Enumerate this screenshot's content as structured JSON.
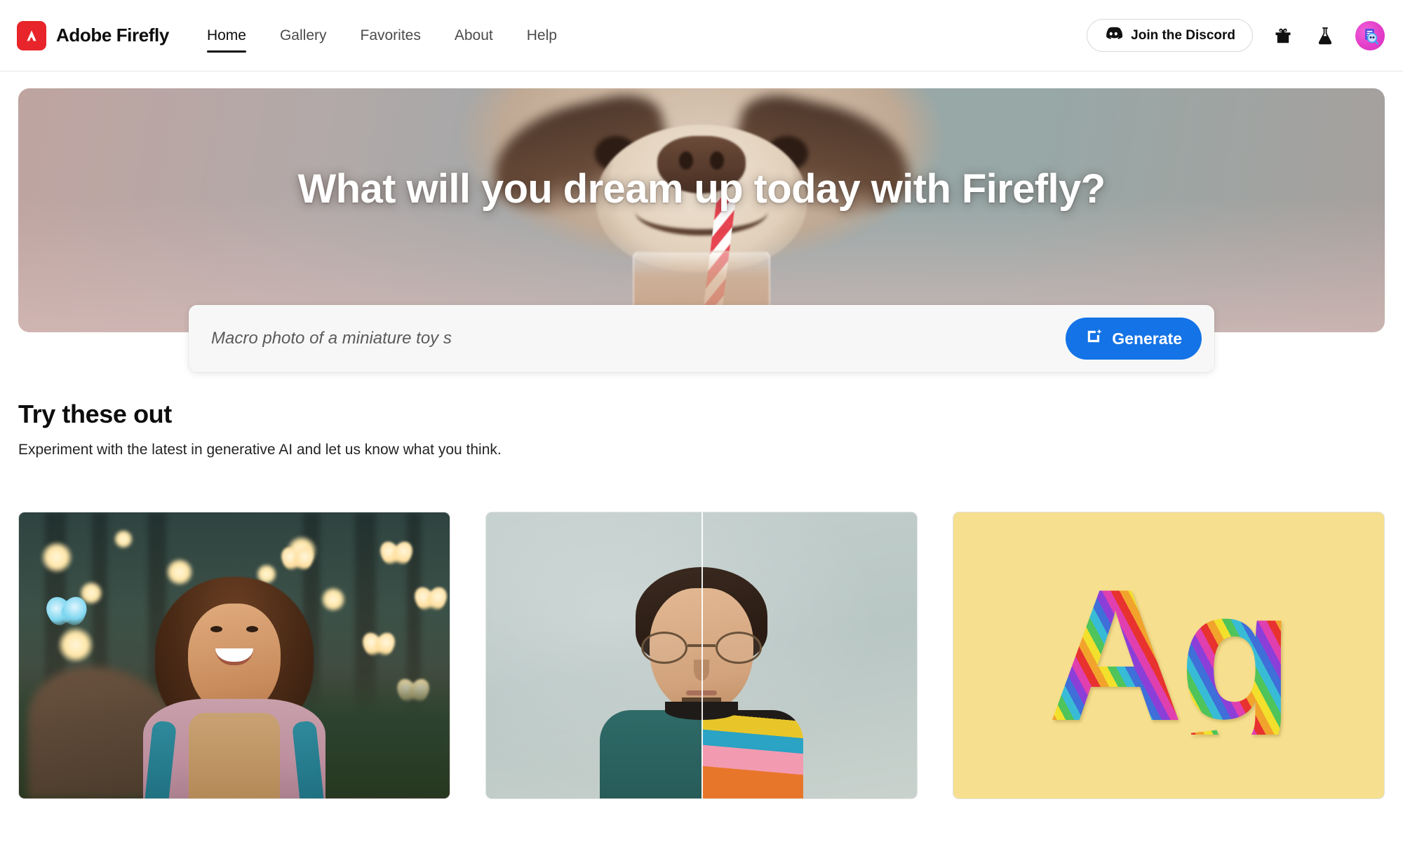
{
  "header": {
    "brand": "Adobe Firefly",
    "logo_color": "#E8252A",
    "nav": [
      {
        "label": "Home",
        "active": true
      },
      {
        "label": "Gallery",
        "active": false
      },
      {
        "label": "Favorites",
        "active": false
      },
      {
        "label": "About",
        "active": false
      },
      {
        "label": "Help",
        "active": false
      }
    ],
    "discord_button": "Join the Discord",
    "gift_icon": "gift-icon",
    "beaker_icon": "beaker-icon",
    "avatar_icon": "avatar"
  },
  "hero": {
    "title": "What will you dream up today with Firefly?",
    "image_description": "sloth drinking through a striped straw"
  },
  "prompt": {
    "value": "Macro photo of a miniature toy s",
    "placeholder": "Macro photo of a miniature toy s",
    "generate_label": "Generate",
    "generate_color": "#1473E6",
    "generate_icon": "generate-sparkle-icon"
  },
  "section": {
    "title": "Try these out",
    "subtitle": "Experiment with the latest in generative AI and let us know what you think."
  },
  "cards": [
    {
      "name": "text-to-image",
      "description": "smiling girl in a glowing forest with butterflies"
    },
    {
      "name": "generative-fill",
      "description": "split portrait of a man, plain sweater on the left and striped sweater on the right"
    },
    {
      "name": "text-effects",
      "description": "Ag letters in rainbow fur on a yellow background",
      "glyph": "Ag",
      "background": "#F6DF8E"
    }
  ]
}
